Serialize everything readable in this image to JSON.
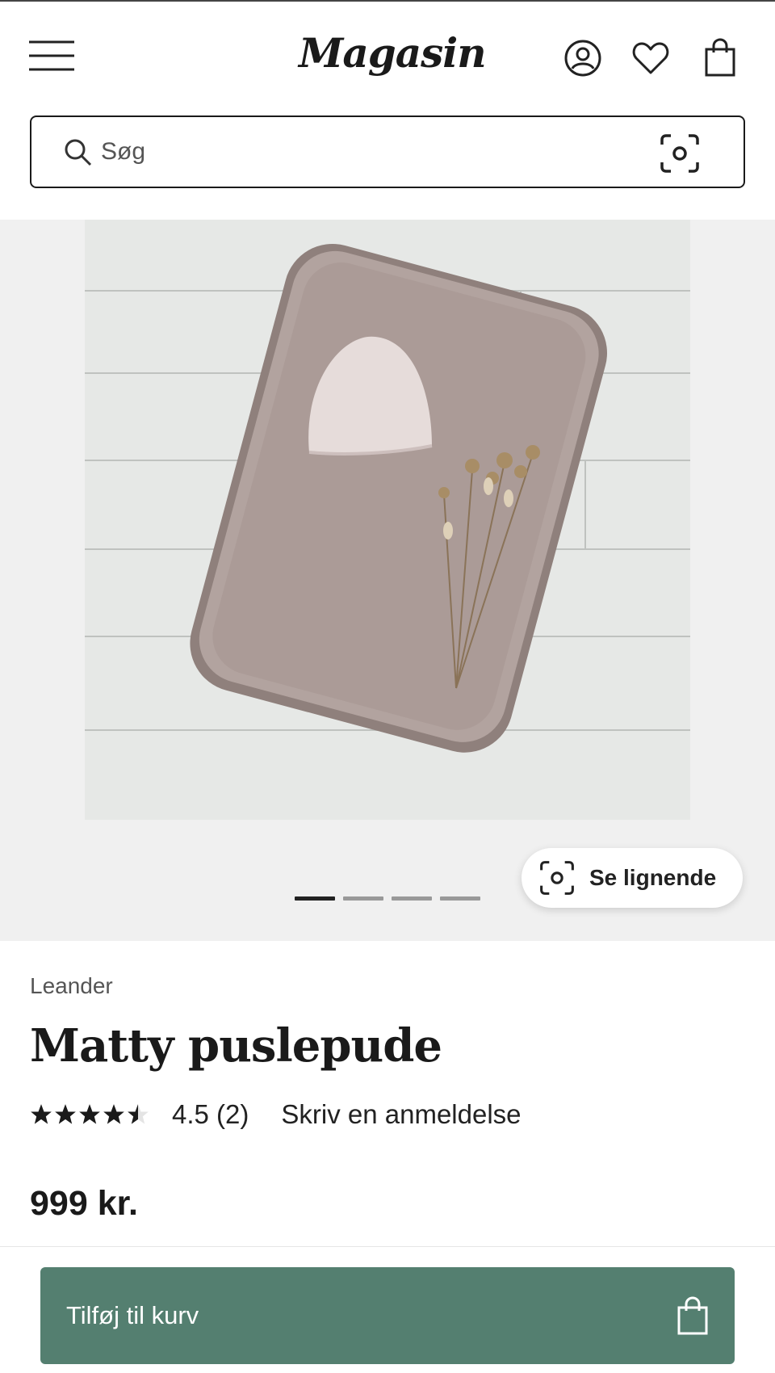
{
  "header": {
    "logo_text": "Magasin",
    "icons": [
      "menu-icon",
      "account-icon",
      "heart-icon",
      "shopping-bag-icon"
    ]
  },
  "search": {
    "placeholder": "Søg",
    "icons": [
      "search-icon",
      "visual-search-icon"
    ]
  },
  "gallery": {
    "image_count": 4,
    "active_index": 0,
    "similar_button_label": "Se lignende"
  },
  "product": {
    "brand": "Leander",
    "name": "Matty puslepude",
    "rating": 4.5,
    "rating_text": "4.5 (2)",
    "review_link": "Skriv en anmeldelse",
    "price": "999 kr."
  },
  "cart": {
    "add_label": "Tilføj til kurv"
  },
  "colors": {
    "primary_button": "#547f70",
    "text": "#1a1a1a",
    "gallery_bg": "#f0f0f0"
  }
}
